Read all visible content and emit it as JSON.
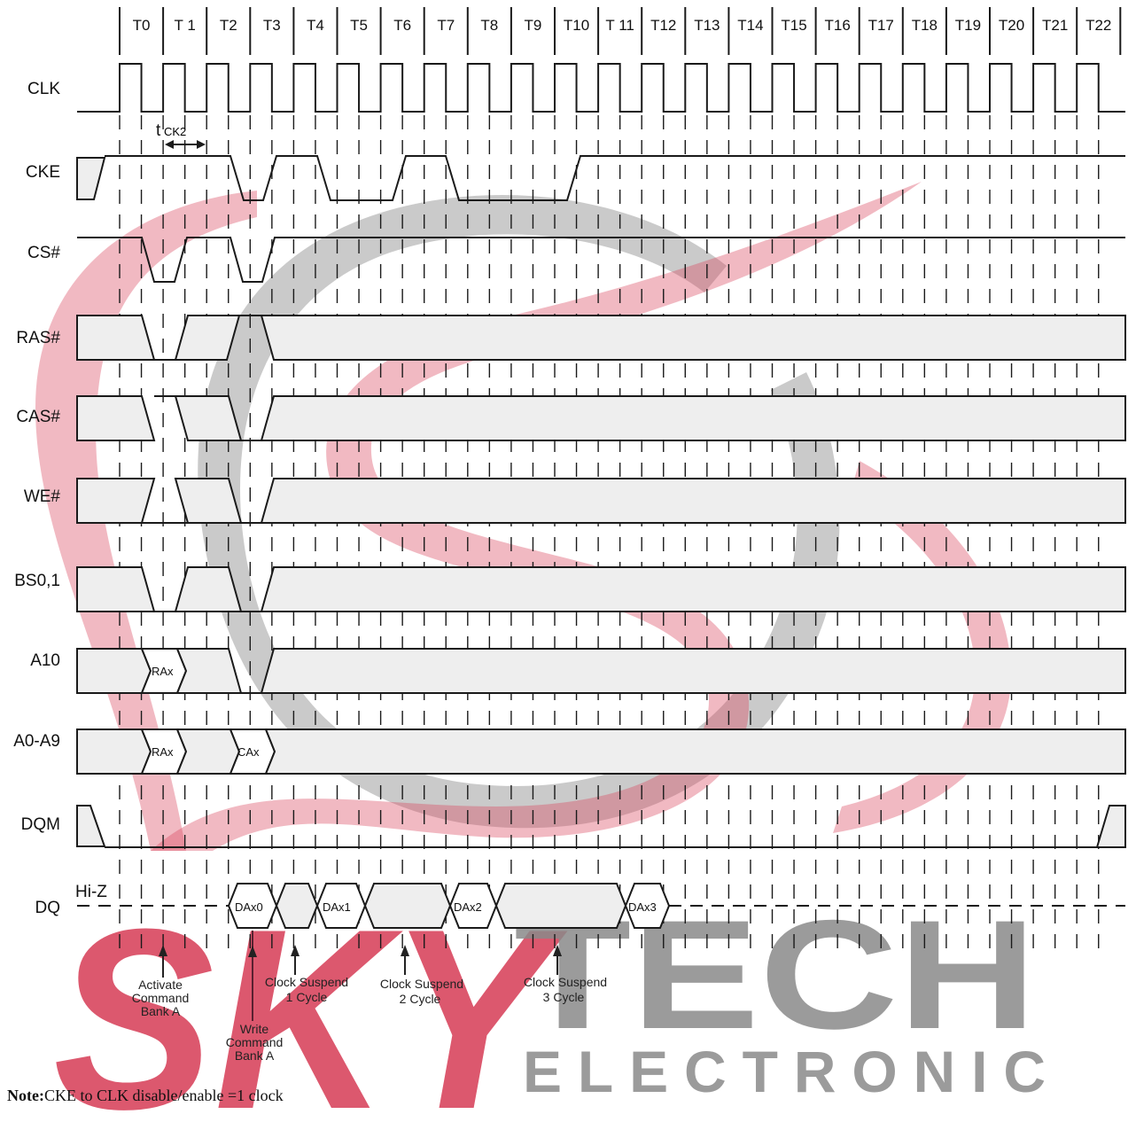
{
  "clock_labels": [
    "T0",
    "T 1",
    "T2",
    "T3",
    "T4",
    "T5",
    "T6",
    "T7",
    "T8",
    "T9",
    "T10",
    "T 11",
    "T12",
    "T13",
    "T14",
    "T15",
    "T16",
    "T17",
    "T18",
    "T19",
    "T20",
    "T21",
    "T22"
  ],
  "signals": {
    "clk": "CLK",
    "cke": "CKE",
    "cs": "CS#",
    "ras": "RAS#",
    "cas": "CAS#",
    "we": "WE#",
    "bs": "BS0,1",
    "a10": "A10",
    "a09": "A0-A9",
    "dqm": "DQM",
    "dq": "DQ"
  },
  "timing_label": {
    "t": "t",
    "sub": "CK2"
  },
  "cells": {
    "a10_rax": "RAx",
    "a09_rax": "RAx",
    "a09_cax": "CAx",
    "dax0": "DAx0",
    "dax1": "DAx1",
    "dax2": "DAx2",
    "dax3": "DAx3",
    "hiz": "Hi-Z"
  },
  "annotations": {
    "activate": [
      "Activate",
      "Command",
      "Bank A"
    ],
    "write": [
      "Write",
      "Command",
      "Bank A"
    ],
    "susp1": [
      "Clock Suspend",
      "1 Cycle"
    ],
    "susp2": [
      "Clock Suspend",
      "2 Cycle"
    ],
    "susp3": [
      "Clock Suspend",
      "3 Cycle"
    ]
  },
  "watermark": {
    "brand": "SKY",
    "brand2": "TECH",
    "sub": "ELECTRONIC"
  },
  "note": {
    "label": "Note:",
    "text": "CKE to CLK disable/enable =1 clock"
  },
  "colors": {
    "line": "#1a1a1a",
    "fill": "#eeeeee",
    "watermark_red": "#d9475f",
    "watermark_gray": "#8a8a8a"
  }
}
